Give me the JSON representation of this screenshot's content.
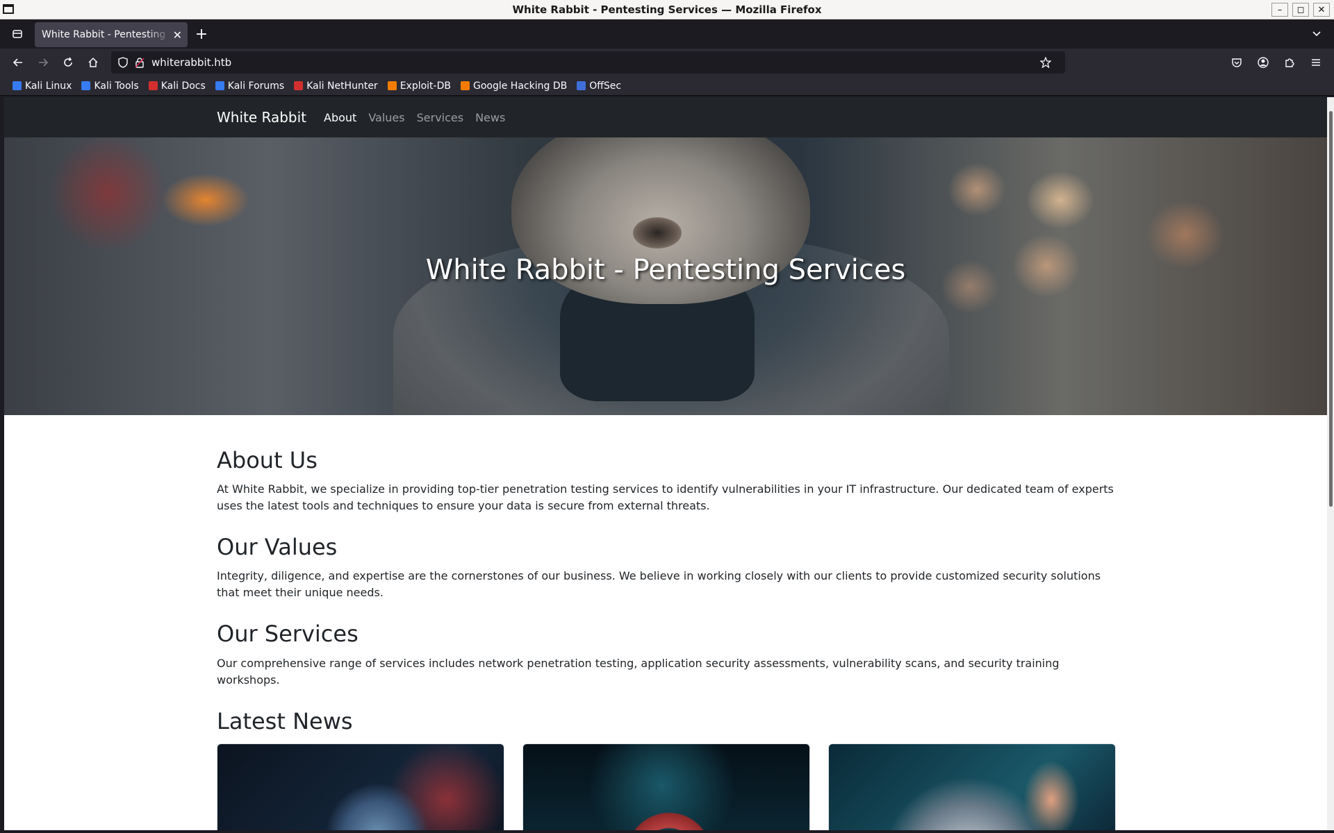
{
  "window": {
    "title": "White Rabbit - Pentesting Services — Mozilla Firefox"
  },
  "tab": {
    "label": "White Rabbit - Pentesting Services"
  },
  "urlbar": {
    "url": "whiterabbit.htb"
  },
  "bookmarks": [
    {
      "label": "Kali Linux",
      "color": "#367bf0"
    },
    {
      "label": "Kali Tools",
      "color": "#367bf0"
    },
    {
      "label": "Kali Docs",
      "color": "#d32f2f"
    },
    {
      "label": "Kali Forums",
      "color": "#367bf0"
    },
    {
      "label": "Kali NetHunter",
      "color": "#d32f2f"
    },
    {
      "label": "Exploit-DB",
      "color": "#f57c00"
    },
    {
      "label": "Google Hacking DB",
      "color": "#f57c00"
    },
    {
      "label": "OffSec",
      "color": "#3f6fd8"
    }
  ],
  "site": {
    "brand": "White Rabbit",
    "nav": [
      "About",
      "Values",
      "Services",
      "News"
    ],
    "hero_title": "White Rabbit - Pentesting Services",
    "sections": [
      {
        "title": "About Us",
        "text": "At White Rabbit, we specialize in providing top-tier penetration testing services to identify vulnerabilities in your IT infrastructure. Our dedicated team of experts uses the latest tools and techniques to ensure your data is secure from external threats."
      },
      {
        "title": "Our Values",
        "text": "Integrity, diligence, and expertise are the cornerstones of our business. We believe in working closely with our clients to provide customized security solutions that meet their unique needs."
      },
      {
        "title": "Our Services",
        "text": "Our comprehensive range of services includes network penetration testing, application security assessments, vulnerability scans, and security training workshops."
      }
    ],
    "news_title": "Latest News"
  }
}
